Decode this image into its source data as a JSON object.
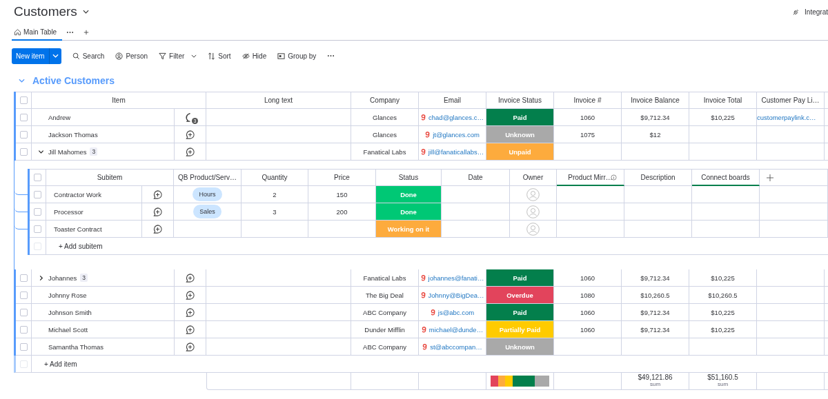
{
  "board": {
    "title": "Customers",
    "integrate": "Integrat"
  },
  "tabs": [
    {
      "label": "Main Table",
      "selected": true
    }
  ],
  "toolbar": {
    "new_item": "New item",
    "actions": [
      {
        "kind": "search",
        "label": "Search"
      },
      {
        "kind": "person",
        "label": "Person"
      },
      {
        "kind": "filter",
        "label": "Filter"
      },
      {
        "kind": "sort",
        "label": "Sort"
      },
      {
        "kind": "hide",
        "label": "Hide"
      },
      {
        "kind": "group",
        "label": "Group by"
      }
    ]
  },
  "group": {
    "title": "Active Customers",
    "expanded": true
  },
  "table": {
    "select_all_checked": false,
    "columns": [
      "Item",
      "Long text",
      "Company",
      "Email",
      "Invoice Status",
      "Invoice #",
      "Invoice Balance",
      "Invoice Total",
      "Customer Pay Li…"
    ],
    "rows": [
      {
        "name": "Andrew",
        "checked": false,
        "updates": "3",
        "company": "Glances",
        "email": "chad@glances.c…",
        "status": {
          "label": "Paid",
          "color": "#037f4c"
        },
        "invoice_no": "1060",
        "balance": "$9,712.34",
        "total": "$10,225",
        "pay_link": "customerpaylink.c…"
      },
      {
        "name": "Jackson Thomas",
        "checked": false,
        "company": "Glances",
        "email": "jt@glances.com",
        "status": {
          "label": "Unknown",
          "color": "#a9a9a9"
        },
        "invoice_no": "1075",
        "balance": "$12"
      },
      {
        "name": "Jill Mahomes",
        "checked": false,
        "subitem_count": "3",
        "expanded": true,
        "company": "Fanatical Labs",
        "email": "jill@fanaticallabs…",
        "status": {
          "label": "Unpaid",
          "color": "#fdab3d"
        },
        "subitems": {
          "select_all_checked": false,
          "columns": [
            {
              "label": "Subitem",
              "linked": false,
              "info": false
            },
            {
              "label": "QB Product/Serv…",
              "linked": false,
              "info": false
            },
            {
              "label": "Quantity",
              "linked": false,
              "info": false
            },
            {
              "label": "Price",
              "linked": false,
              "info": false
            },
            {
              "label": "Status",
              "linked": false,
              "info": false
            },
            {
              "label": "Date",
              "linked": false,
              "info": false
            },
            {
              "label": "Owner",
              "linked": false,
              "info": false
            },
            {
              "label": "Product Mirr…",
              "linked": true,
              "info": true
            },
            {
              "label": "Description",
              "linked": false,
              "info": false
            },
            {
              "label": "Connect boards",
              "linked": true,
              "info": false
            }
          ],
          "rows": [
            {
              "name": "Contractor Work",
              "checked": false,
              "product": "Hours",
              "quantity": "2",
              "price": "150",
              "status": {
                "label": "Done",
                "color": "#00c875"
              }
            },
            {
              "name": "Processor",
              "checked": false,
              "product": "Sales",
              "quantity": "3",
              "price": "200",
              "status": {
                "label": "Done",
                "color": "#00c875"
              }
            },
            {
              "name": "Toaster Contract",
              "checked": false,
              "status": {
                "label": "Working on it",
                "color": "#fdab3d"
              }
            }
          ],
          "add_label": "+ Add subitem",
          "add_checkbox_disabled": true
        }
      },
      {
        "name": "Johannes",
        "checked": false,
        "subitem_count": "3",
        "expanded": false,
        "company": "Fanatical Labs",
        "email": "johannes@fanati…",
        "status": {
          "label": "Paid",
          "color": "#037f4c"
        },
        "invoice_no": "1060",
        "balance": "$9,712.34",
        "total": "$10,225"
      },
      {
        "name": "Johnny Rose",
        "checked": false,
        "company": "The Big Deal",
        "email": "Johnny@BigDea…",
        "status": {
          "label": "Overdue",
          "color": "#e2445c"
        },
        "invoice_no": "1080",
        "balance": "$10,260.5",
        "total": "$10,260.5"
      },
      {
        "name": "Johnson Smith",
        "checked": false,
        "company": "ABC Company",
        "email": "js@abc.com",
        "status": {
          "label": "Paid",
          "color": "#037f4c"
        },
        "invoice_no": "1060",
        "balance": "$9,712.34",
        "total": "$10,225"
      },
      {
        "name": "Michael Scott",
        "checked": false,
        "company": "Dunder Mifflin",
        "email": "michael@dunde…",
        "status": {
          "label": "Partially Paid",
          "color": "#ffcb00"
        },
        "invoice_no": "1060",
        "balance": "$9,712.34",
        "total": "$10,225"
      },
      {
        "name": "Samantha Thomas",
        "checked": false,
        "company": "ABC Company",
        "email": "st@abccompan…",
        "status": {
          "label": "Unknown",
          "color": "#a9a9a9"
        }
      }
    ],
    "add_label": "+ Add item",
    "add_checkbox_disabled": true,
    "footer": {
      "status_summary": [
        {
          "color": "#e2445c"
        },
        {
          "color": "#fdab3d"
        },
        {
          "color": "#ffcb00"
        },
        {
          "color": "#037f4c"
        },
        {
          "color": "#a9a9a9"
        }
      ],
      "balance": {
        "value": "$49,121.86",
        "label": "sum"
      },
      "total": {
        "value": "$51,160.5",
        "label": "sum"
      }
    }
  }
}
